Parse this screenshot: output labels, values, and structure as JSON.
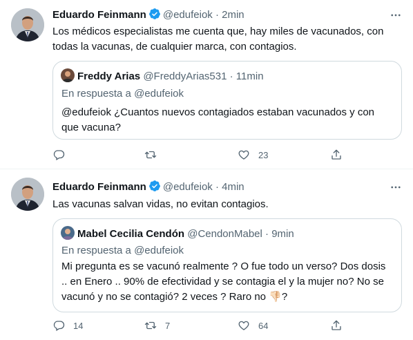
{
  "tweets": [
    {
      "author": "Eduardo Feinmann",
      "handle": "@edufeiok",
      "dot": "·",
      "time": "2min",
      "text": "Los médicos especialistas me cuenta que, hay miles de vacunados, con todas la vacunas, de cualquier marca, con contagios.",
      "quote": {
        "author": "Freddy Arias",
        "handle": "@FreddyArias531",
        "dot": "·",
        "time": "11min",
        "reply_prefix": "En respuesta a",
        "reply_to": "@edufeiok",
        "text": "@edufeiok ¿Cuantos nuevos contagiados estaban vacunados y con que vacuna?"
      },
      "actions": {
        "reply_count": "",
        "retweet_count": "",
        "like_count": "23"
      }
    },
    {
      "author": "Eduardo Feinmann",
      "handle": "@edufeiok",
      "dot": "·",
      "time": "4min",
      "text": "Las vacunas salvan vidas, no evitan contagios.",
      "quote": {
        "author": "Mabel Cecilia Cendón",
        "handle": "@CendonMabel",
        "dot": "·",
        "time": "9min",
        "reply_prefix": "En respuesta a",
        "reply_to": "@edufeiok",
        "text": "Mi pregunta es se vacunó realmente ? O fue todo un verso? Dos dosis .. en Enero .. 90% de efectividad y se contagia el y la mujer no? No se vacunó y no se contagió? 2 veces ? Raro no 👎🏻?"
      },
      "actions": {
        "reply_count": "14",
        "retweet_count": "7",
        "like_count": "64"
      }
    }
  ],
  "colors": {
    "verified": "#1d9bf0",
    "secondary_text": "#536471",
    "border": "#cfd9de"
  }
}
